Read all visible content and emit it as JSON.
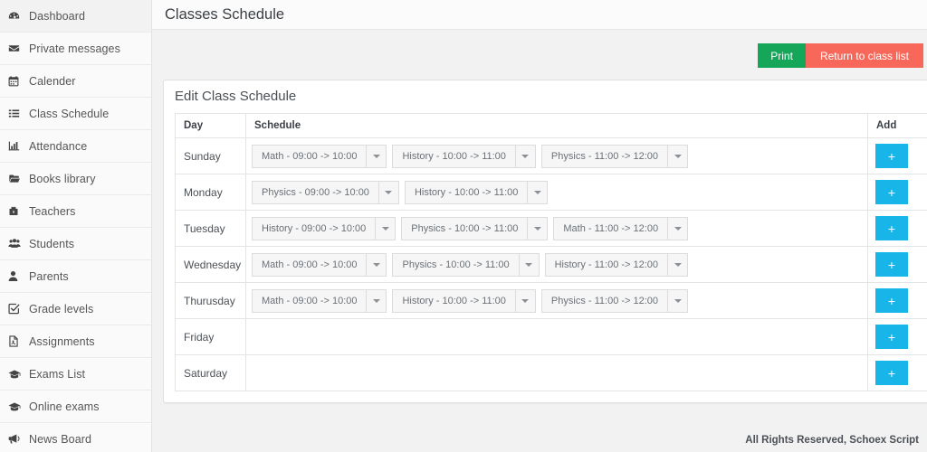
{
  "sidebar": {
    "items": [
      {
        "label": "Dashboard",
        "icon": "dashboard-icon"
      },
      {
        "label": "Private messages",
        "icon": "envelope-icon"
      },
      {
        "label": "Calender",
        "icon": "calendar-icon"
      },
      {
        "label": "Class Schedule",
        "icon": "list-icon"
      },
      {
        "label": "Attendance",
        "icon": "bar-chart-icon"
      },
      {
        "label": "Books library",
        "icon": "folder-open-icon"
      },
      {
        "label": "Teachers",
        "icon": "briefcase-icon"
      },
      {
        "label": "Students",
        "icon": "group-icon"
      },
      {
        "label": "Parents",
        "icon": "user-icon"
      },
      {
        "label": "Grade levels",
        "icon": "check-square-icon"
      },
      {
        "label": "Assignments",
        "icon": "file-text-icon"
      },
      {
        "label": "Exams List",
        "icon": "graduation-cap-icon"
      },
      {
        "label": "Online exams",
        "icon": "graduation-cap-icon"
      },
      {
        "label": "News Board",
        "icon": "bullhorn-icon"
      }
    ]
  },
  "header": {
    "title": "Classes Schedule"
  },
  "toolbar": {
    "print_label": "Print",
    "return_label": "Return to class list",
    "print_color": "#16a65a",
    "return_color": "#f8685a"
  },
  "panel": {
    "heading": "Edit Class Schedule",
    "columns": [
      "Day",
      "Schedule",
      "Add"
    ],
    "add_button_label": "+",
    "add_button_color": "#18b5e8",
    "rows": [
      {
        "day": "Sunday",
        "schedule": [
          "Math - 09:00 -> 10:00",
          "History - 10:00 -> 11:00",
          "Physics - 11:00 -> 12:00"
        ]
      },
      {
        "day": "Monday",
        "schedule": [
          "Physics - 09:00 -> 10:00",
          "History - 10:00 -> 11:00"
        ]
      },
      {
        "day": "Tuesday",
        "schedule": [
          "History - 09:00 -> 10:00",
          "Physics - 10:00 -> 11:00",
          "Math - 11:00 -> 12:00"
        ]
      },
      {
        "day": "Wednesday",
        "schedule": [
          "Math - 09:00 -> 10:00",
          "Physics - 10:00 -> 11:00",
          "History - 11:00 -> 12:00"
        ]
      },
      {
        "day": "Thurusday",
        "schedule": [
          "Math - 09:00 -> 10:00",
          "History - 10:00 -> 11:00",
          "Physics - 11:00 -> 12:00"
        ]
      },
      {
        "day": "Friday",
        "schedule": []
      },
      {
        "day": "Saturday",
        "schedule": []
      }
    ]
  },
  "footer": {
    "text": "All Rights Reserved, Schoex Script"
  }
}
